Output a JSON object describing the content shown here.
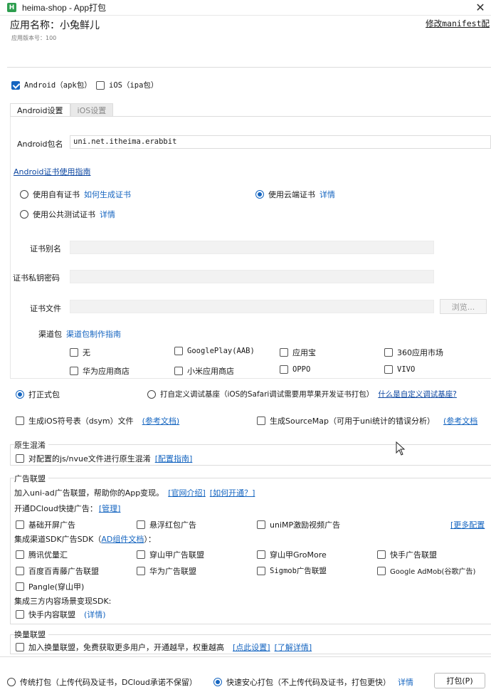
{
  "window": {
    "title": "heima-shop - App打包",
    "app_icon": "H"
  },
  "header": {
    "app_name": "应用名称：小兔鲜儿",
    "version": "应用版本号：100",
    "manifest_link": "修改manifest配"
  },
  "platforms": {
    "android": "Android（apk包）",
    "ios": "iOS（ipa包）",
    "android_checked": true,
    "ios_checked": false
  },
  "tabs": {
    "android": "Android设置",
    "ios": "iOS设置"
  },
  "android": {
    "package_label": "Android包名",
    "package_value": "uni.net.itheima.erabbit",
    "cert_guide": "Android证书使用指南",
    "cert_own": "使用自有证书",
    "cert_own_link": "如何生成证书",
    "cert_cloud": "使用云端证书",
    "cert_cloud_link": "详情",
    "cert_public": "使用公共测试证书",
    "cert_public_link": "详情",
    "alias_label": "证书别名",
    "password_label": "证书私钥密码",
    "file_label": "证书文件",
    "browse": "浏览...",
    "channel_label": "渠道包",
    "channel_link": "渠道包制作指南",
    "channels": [
      "无",
      "GooglePlay(AAB)",
      "应用宝",
      "360应用市场",
      "华为应用商店",
      "小米应用商店",
      "OPPO",
      "VIVO"
    ]
  },
  "build": {
    "formal": "打正式包",
    "custom": "打自定义调试基座（iOS的Safari调试需要用苹果开发证书打包）",
    "custom_link": "什么是自定义调试基座?",
    "dsym": "生成iOS符号表（dsym）文件",
    "dsym_link": "(参考文档)",
    "sourcemap": "生成SourceMap（可用于uni统计的错误分析）",
    "sourcemap_link": "(参考文档"
  },
  "obfuscate": {
    "title": "原生混淆",
    "label": "对配置的js/nvue文件进行原生混淆",
    "link": "[配置指南]"
  },
  "ads": {
    "title": "广告联盟",
    "intro": "加入uni-ad广告联盟，帮助你的App变现。",
    "intro_link1": "[官网介绍]",
    "intro_link2": "[如何开通？]",
    "quick_label": "开通DCloud快捷广告：",
    "quick_link": "[管理]",
    "quick_items": [
      "基础开屏广告",
      "悬浮红包广告",
      "uniMP激励视频广告"
    ],
    "more_link": "[更多配置",
    "sdk_label_pre": "集成渠道SDK广告SDK（",
    "sdk_link": "AD组件文档",
    "sdk_label_post": "）：",
    "sdk_items": [
      "腾讯优量汇",
      "穿山甲广告联盟",
      "穿山甲GroMore",
      "快手广告联盟",
      "百度百青藤广告联盟",
      "华为广告联盟",
      "Sigmob广告联盟",
      "Google AdMob(谷歌广告)",
      "Pangle(穿山甲)"
    ],
    "content_label": "集成三方内容场景变现SDK:",
    "content_item": "快手内容联盟",
    "content_link": "(详情)"
  },
  "exchange": {
    "title": "换量联盟",
    "label": "加入换量联盟，免费获取更多用户，开通越早，权重越高",
    "link1": "[点此设置]",
    "link2": "[了解详情]"
  },
  "footer": {
    "traditional": "传统打包（上传代码及证书，DCloud承诺不保留）",
    "fast": "快速安心打包（不上传代码及证书，打包更快）",
    "fast_link": "详情",
    "pack": "打包(P)"
  }
}
